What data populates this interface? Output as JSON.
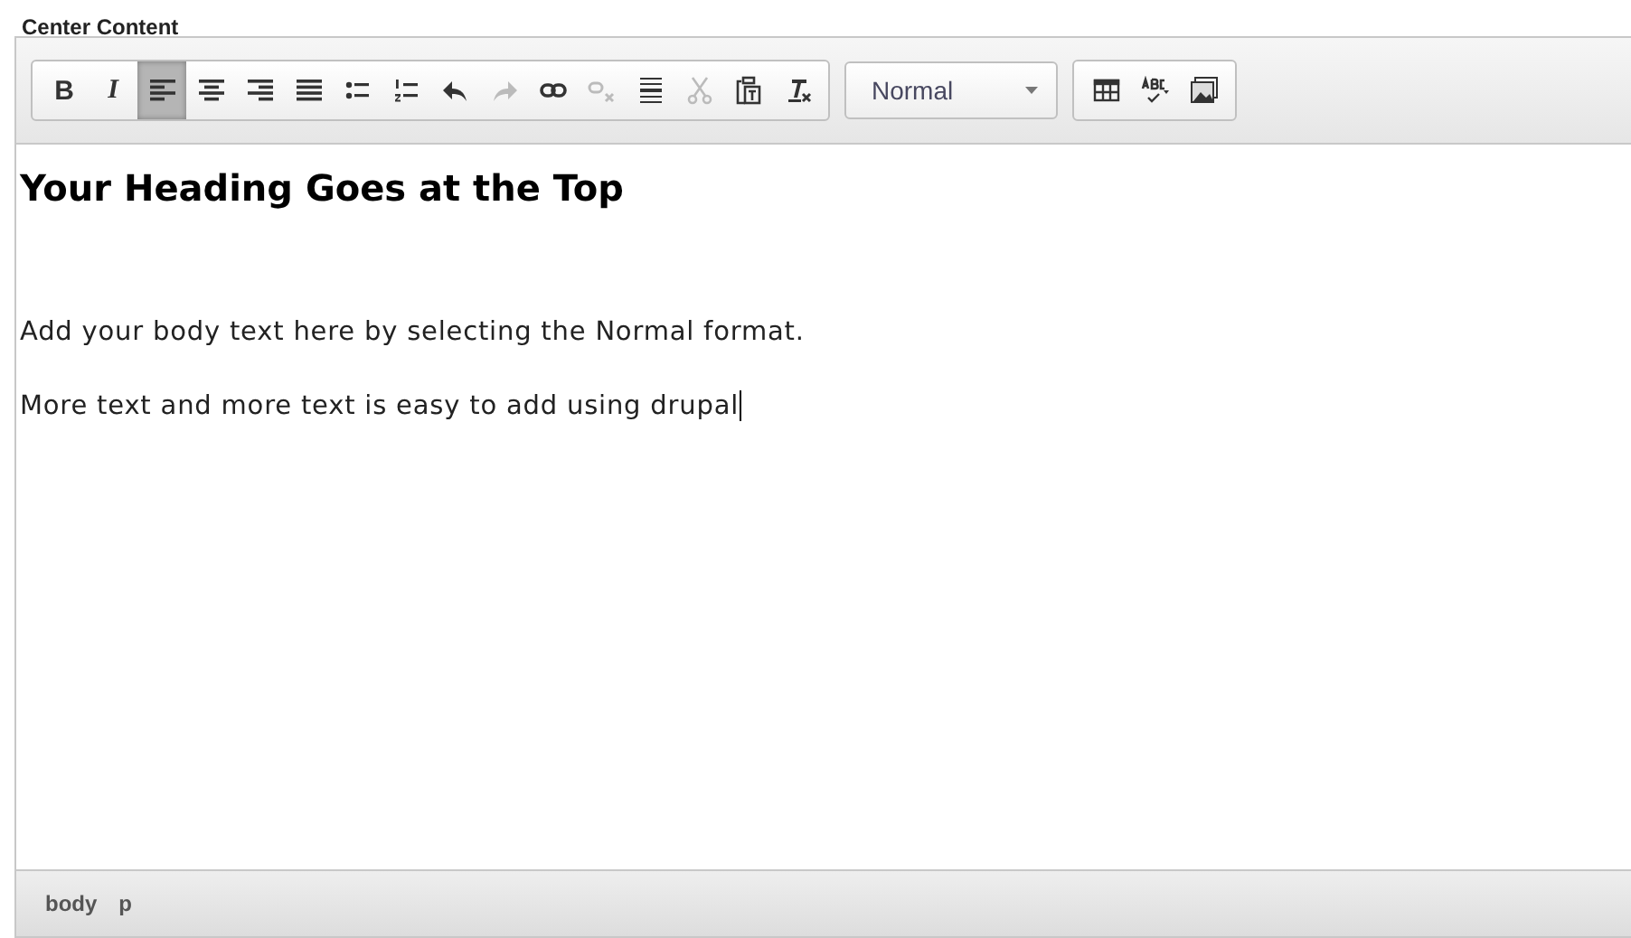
{
  "field_label": "Center Content",
  "toolbar": {
    "groups": [
      {
        "buttons": [
          {
            "kind": "bold",
            "text": "B",
            "selected": false,
            "disabled": false
          },
          {
            "kind": "italic",
            "text": "I",
            "selected": false,
            "disabled": false
          },
          {
            "kind": "align-left",
            "selected": true,
            "disabled": false
          },
          {
            "kind": "align-center",
            "selected": false,
            "disabled": false
          },
          {
            "kind": "align-right",
            "selected": false,
            "disabled": false
          },
          {
            "kind": "justify",
            "selected": false,
            "disabled": false
          },
          {
            "kind": "bullets",
            "selected": false,
            "disabled": false
          },
          {
            "kind": "numbers",
            "selected": false,
            "disabled": false
          },
          {
            "kind": "undo",
            "selected": false,
            "disabled": false
          },
          {
            "kind": "redo",
            "selected": false,
            "disabled": true
          },
          {
            "kind": "link",
            "selected": false,
            "disabled": false
          },
          {
            "kind": "unlink",
            "selected": false,
            "disabled": true
          },
          {
            "kind": "rule",
            "selected": false,
            "disabled": false
          },
          {
            "kind": "cut",
            "selected": false,
            "disabled": true
          },
          {
            "kind": "paste",
            "selected": false,
            "disabled": false
          },
          {
            "kind": "clear",
            "selected": false,
            "disabled": false
          }
        ]
      },
      {
        "format": "Normal"
      },
      {
        "buttons": [
          {
            "kind": "table",
            "disabled": false
          },
          {
            "kind": "spell",
            "disabled": false
          },
          {
            "kind": "image",
            "disabled": false
          }
        ]
      }
    ]
  },
  "content": {
    "heading": "Your Heading Goes at the Top",
    "paragraphs": [
      "Add your body text here by selecting the Normal format.",
      "More text and more text is easy to add using drupal"
    ]
  },
  "path": [
    "body",
    "p"
  ]
}
